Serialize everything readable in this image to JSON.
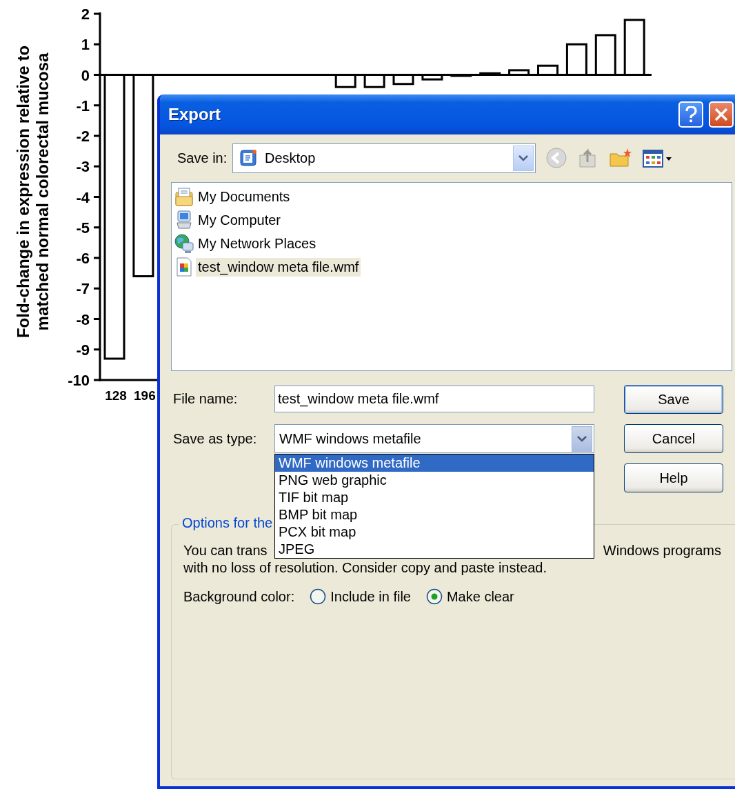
{
  "chart": {
    "chart_data": {
      "type": "bar",
      "ylabel": "Fold-change in expression relative to matched normal colorectal mucosa",
      "categories": [
        "128",
        "196",
        null,
        null,
        null,
        null,
        null,
        null,
        null,
        null,
        null,
        null,
        null,
        null,
        null,
        null,
        null,
        null,
        null
      ],
      "values": [
        -9.3,
        -6.6,
        null,
        null,
        null,
        null,
        null,
        null,
        -0.4,
        -0.4,
        -0.3,
        -0.15,
        0,
        0.05,
        0.15,
        0.3,
        1.0,
        1.3,
        1.8
      ],
      "ylim": [
        -10,
        2
      ],
      "yticks": [
        -10,
        -9,
        -8,
        -7,
        -6,
        -5,
        -4,
        -3,
        -2,
        -1,
        0,
        1,
        2
      ]
    }
  },
  "dialog": {
    "title": "Export",
    "save_in": {
      "label": "Save in:",
      "value": "Desktop"
    },
    "files": [
      {
        "name": "My Documents",
        "kind": "documents",
        "selected": false
      },
      {
        "name": "My Computer",
        "kind": "computer",
        "selected": false
      },
      {
        "name": "My Network Places",
        "kind": "network",
        "selected": false
      },
      {
        "name": "test_window meta file.wmf",
        "kind": "file",
        "selected": true
      }
    ],
    "file_name": {
      "label": "File name:",
      "value": "test_window meta file.wmf"
    },
    "save_as_type": {
      "label": "Save as type:",
      "value": "WMF windows metafile",
      "expanded": true,
      "options": [
        {
          "label": "WMF windows metafile",
          "selected": true
        },
        {
          "label": "PNG web graphic",
          "selected": false
        },
        {
          "label": "TIF bit map",
          "selected": false
        },
        {
          "label": "BMP bit map",
          "selected": false
        },
        {
          "label": "PCX bit map",
          "selected": false
        },
        {
          "label": "JPEG",
          "selected": false
        }
      ]
    },
    "buttons": [
      {
        "label": "Save",
        "default": true
      },
      {
        "label": "Cancel",
        "default": false
      },
      {
        "label": "Help",
        "default": false
      }
    ],
    "options": {
      "legend": "Options for the",
      "text_left": "You can trans",
      "text_right": "Windows programs",
      "text_line2": "with no loss of resolution. Consider copy and paste instead.",
      "background": {
        "label": "Background color:",
        "choices": [
          {
            "label": "Include in file",
            "selected": false
          },
          {
            "label": "Make clear",
            "selected": true
          }
        ]
      }
    }
  }
}
